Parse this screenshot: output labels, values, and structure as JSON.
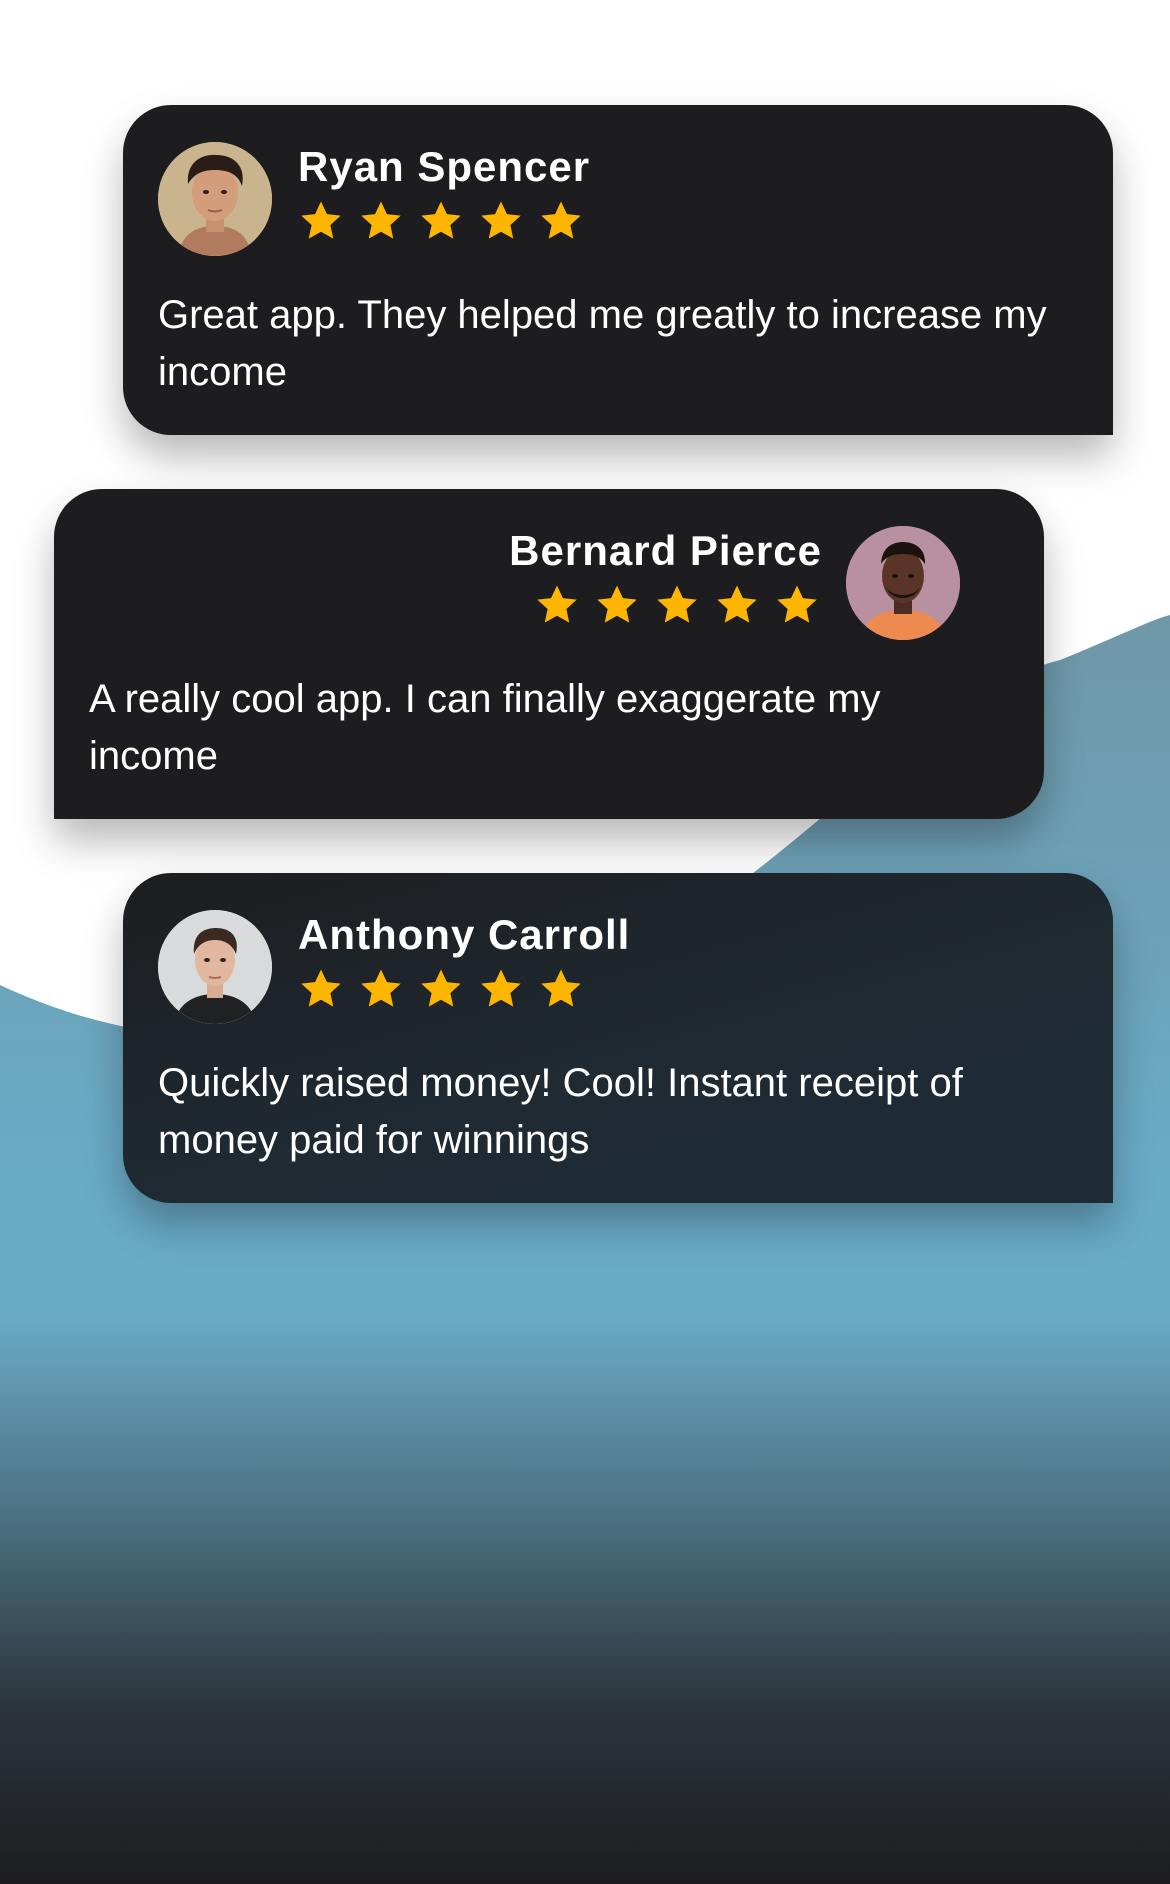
{
  "colors": {
    "card": "#1d1d1f",
    "star": "#fdb600",
    "wave": "#6ba9c5",
    "bottom": "#1d1d1f"
  },
  "reviews": [
    {
      "name": "Ryan Spencer",
      "rating": 5,
      "text": "Great app. They helped me greatly to increase my income",
      "avatar": "avatar-photo-ryan"
    },
    {
      "name": "Bernard Pierce",
      "rating": 5,
      "text": "A really cool app. I can finally exaggerate my income",
      "avatar": "avatar-photo-bernard"
    },
    {
      "name": "Anthony Carroll",
      "rating": 5,
      "text": "Quickly raised money! Cool! Instant receipt of money paid for winnings",
      "avatar": "avatar-photo-anthony"
    }
  ]
}
